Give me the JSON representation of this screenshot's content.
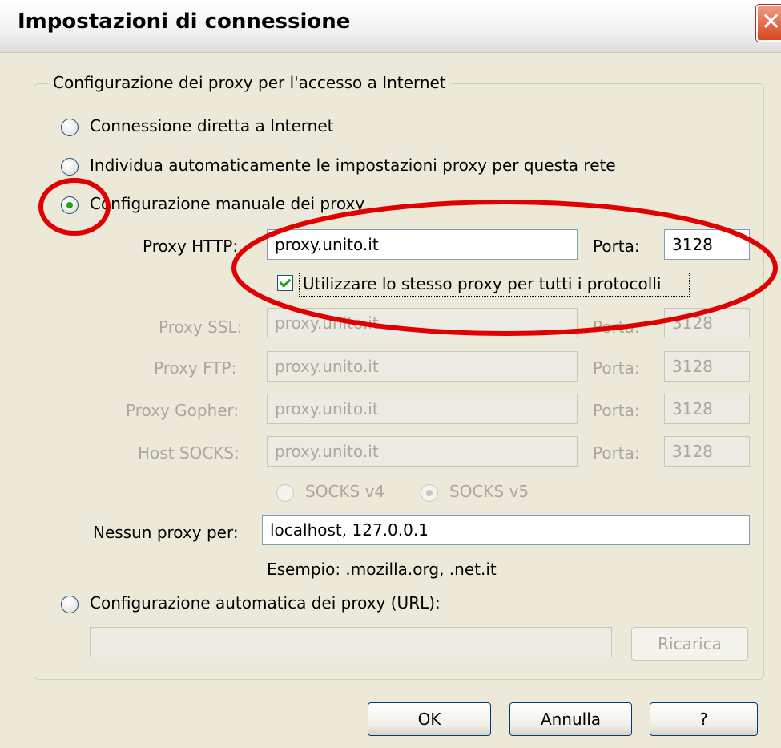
{
  "window": {
    "title": "Impostazioni di connessione"
  },
  "group": {
    "legend": "Configurazione dei proxy per l'accesso a Internet"
  },
  "options": {
    "direct": "Connessione diretta a Internet",
    "auto_detect": "Individua automaticamente le impostazioni proxy per questa rete",
    "manual": "Configurazione manuale dei proxy",
    "auto_url": "Configurazione automatica dei proxy (URL):",
    "selected": "manual"
  },
  "proxies": {
    "http": {
      "label": "Proxy HTTP:",
      "value": "proxy.unito.it",
      "port_label": "Porta:",
      "port": "3128"
    },
    "same_for_all": {
      "label": "Utilizzare lo stesso proxy per tutti i protocolli",
      "checked": true
    },
    "ssl": {
      "label": "Proxy SSL:",
      "value": "proxy.unito.it",
      "port_label": "Porta:",
      "port": "3128"
    },
    "ftp": {
      "label": "Proxy FTP:",
      "value": "proxy.unito.it",
      "port_label": "Porta:",
      "port": "3128"
    },
    "gopher": {
      "label": "Proxy Gopher:",
      "value": "proxy.unito.it",
      "port_label": "Porta:",
      "port": "3128"
    },
    "socks": {
      "label": "Host SOCKS:",
      "value": "proxy.unito.it",
      "port_label": "Porta:",
      "port": "3128"
    },
    "socks_v4": "SOCKS v4",
    "socks_v5": "SOCKS v5",
    "socks_selected": "v5"
  },
  "no_proxy": {
    "label": "Nessun proxy per:",
    "value": "localhost, 127.0.0.1",
    "example": "Esempio: .mozilla.org, .net.it"
  },
  "auto_url": {
    "value": "",
    "reload_label": "Ricarica"
  },
  "buttons": {
    "ok": "OK",
    "cancel": "Annulla",
    "help": "?"
  },
  "annotation": {
    "color": "#e00000"
  }
}
